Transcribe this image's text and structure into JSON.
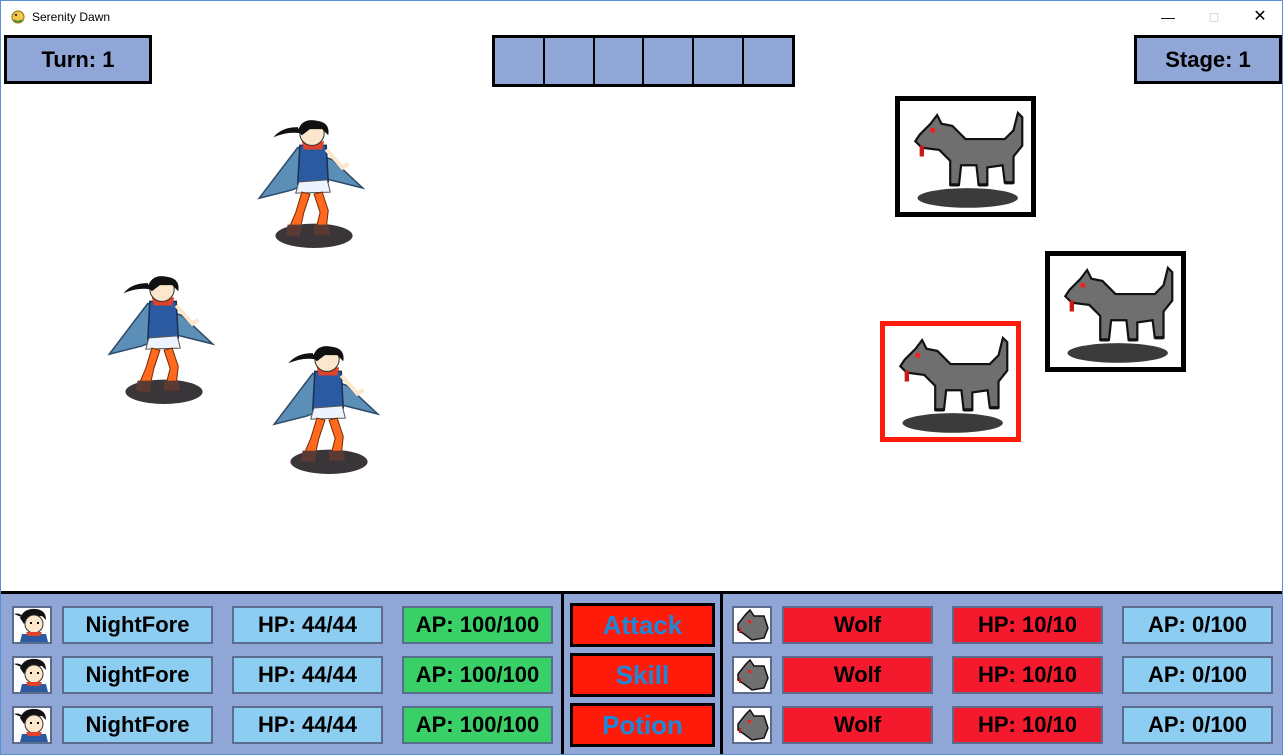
{
  "window": {
    "title": "Serenity Dawn",
    "minimize": "—",
    "maximize": "□",
    "close": "✕"
  },
  "hud": {
    "turn": "Turn: 1",
    "stage": "Stage: 1",
    "queue_slots": 6
  },
  "colors": {
    "panel": "#8fa6d6",
    "hero_name_bg": "#8ecdf2",
    "hero_ap_bg": "#3ad068",
    "enemy_bg": "#f31a2e",
    "action_bg": "#ff1a0a",
    "action_text": "#1e88d8",
    "selected_frame": "#ff1a0a"
  },
  "field": {
    "heroes": [
      {
        "icon": "heroine-sprite-icon"
      },
      {
        "icon": "heroine-sprite-icon"
      },
      {
        "icon": "heroine-sprite-icon"
      }
    ],
    "enemies": [
      {
        "icon": "wolf-sprite-icon",
        "selected": false
      },
      {
        "icon": "wolf-sprite-icon",
        "selected": false
      },
      {
        "icon": "wolf-sprite-icon",
        "selected": true
      }
    ]
  },
  "party": [
    {
      "name": "NightFore",
      "hp": "HP: 44/44",
      "ap": "AP: 100/100"
    },
    {
      "name": "NightFore",
      "hp": "HP: 44/44",
      "ap": "AP: 100/100"
    },
    {
      "name": "NightFore",
      "hp": "HP: 44/44",
      "ap": "AP: 100/100"
    }
  ],
  "actions": {
    "attack": "Attack",
    "skill": "Skill",
    "potion": "Potion"
  },
  "enemies": [
    {
      "name": "Wolf",
      "hp": "HP: 10/10",
      "ap": "AP: 0/100"
    },
    {
      "name": "Wolf",
      "hp": "HP: 10/10",
      "ap": "AP: 0/100"
    },
    {
      "name": "Wolf",
      "hp": "HP: 10/10",
      "ap": "AP: 0/100"
    }
  ]
}
